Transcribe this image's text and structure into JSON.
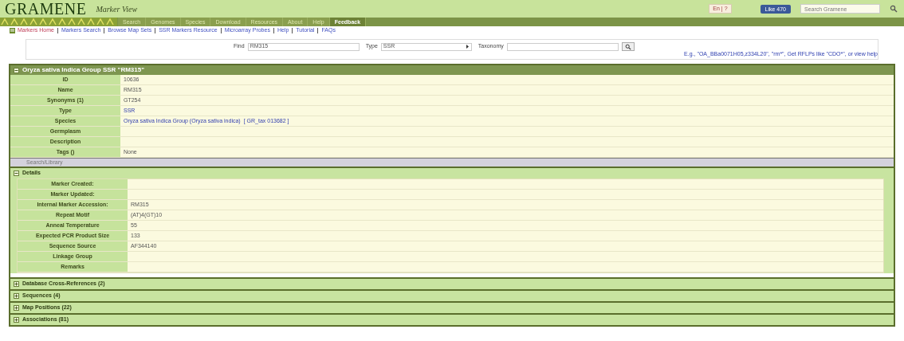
{
  "header": {
    "logo": "GRAMENE",
    "subtitle": "Marker View",
    "language": "En | ?",
    "like": "Like 470",
    "search": {
      "placeholder": "Search Gramene"
    }
  },
  "nav": [
    {
      "label": "Search",
      "selected": false
    },
    {
      "label": "Genomes",
      "selected": false
    },
    {
      "label": "Species",
      "selected": false
    },
    {
      "label": "Download",
      "selected": false
    },
    {
      "label": "Resources",
      "selected": false
    },
    {
      "label": "About",
      "selected": false
    },
    {
      "label": "Help",
      "selected": false
    },
    {
      "label": "Feedback",
      "selected": true
    }
  ],
  "subnav": [
    {
      "label": "Markers Home",
      "selected": true
    },
    {
      "label": "Markers Search",
      "selected": false
    },
    {
      "label": "Browse Map Sets",
      "selected": false
    },
    {
      "label": "SSR Markers Resource",
      "selected": false
    },
    {
      "label": "Microarray Probes",
      "selected": false
    },
    {
      "label": "Help",
      "selected": false
    },
    {
      "label": "Tutorial",
      "selected": false
    },
    {
      "label": "FAQs",
      "selected": false
    }
  ],
  "search_form": {
    "find_label": "Find",
    "find_value": "RM315",
    "type_label": "Type",
    "type_value": "SSR",
    "taxonomy_label": "Taxonomy",
    "hint": "E.g., \"OA_BBa0071H05,z334L20\", \"rm*\", Get RFLPs like \"CDO*\", or view help"
  },
  "marker": {
    "title": "Oryza sativa Indica Group SSR \"RM315\"",
    "rows": [
      {
        "label": "ID",
        "value": "10636"
      },
      {
        "label": "Name",
        "value": "RM315"
      },
      {
        "label": "Synonyms (1)",
        "value": "GT254"
      },
      {
        "label": "Type",
        "value": "SSR",
        "link": true
      },
      {
        "label": "Species",
        "value": "Oryza sativa Indica Group (Oryza sativa indica)",
        "link": true,
        "extra": "[ GR_tax 013682 ]"
      },
      {
        "label": "Germplasm"
      },
      {
        "label": "Description"
      },
      {
        "label": "Tags ()",
        "value": "None"
      }
    ],
    "bar": "Search/Library"
  },
  "sections": [
    {
      "title": "Details",
      "expanded": true,
      "rows": [
        {
          "label": "Marker Created:"
        },
        {
          "label": "Marker Updated:"
        },
        {
          "label": "Internal Marker Accession:",
          "value": "RM315"
        },
        {
          "label": "Repeat Motif",
          "value": "(AT)4(GT)10"
        },
        {
          "label": "Anneal Temperature",
          "value": "55"
        },
        {
          "label": "Expected PCR Product Size",
          "value": "133"
        },
        {
          "label": "Sequence Source",
          "value": "AF344140"
        },
        {
          "label": "Linkage Group"
        },
        {
          "label": "Remarks"
        }
      ]
    },
    {
      "title": "Database Cross-References (2)",
      "expanded": false
    },
    {
      "title": "Sequences (4)",
      "expanded": false
    },
    {
      "title": "Map Positions (22)",
      "expanded": false
    },
    {
      "title": "Associations (81)",
      "expanded": false
    }
  ]
}
